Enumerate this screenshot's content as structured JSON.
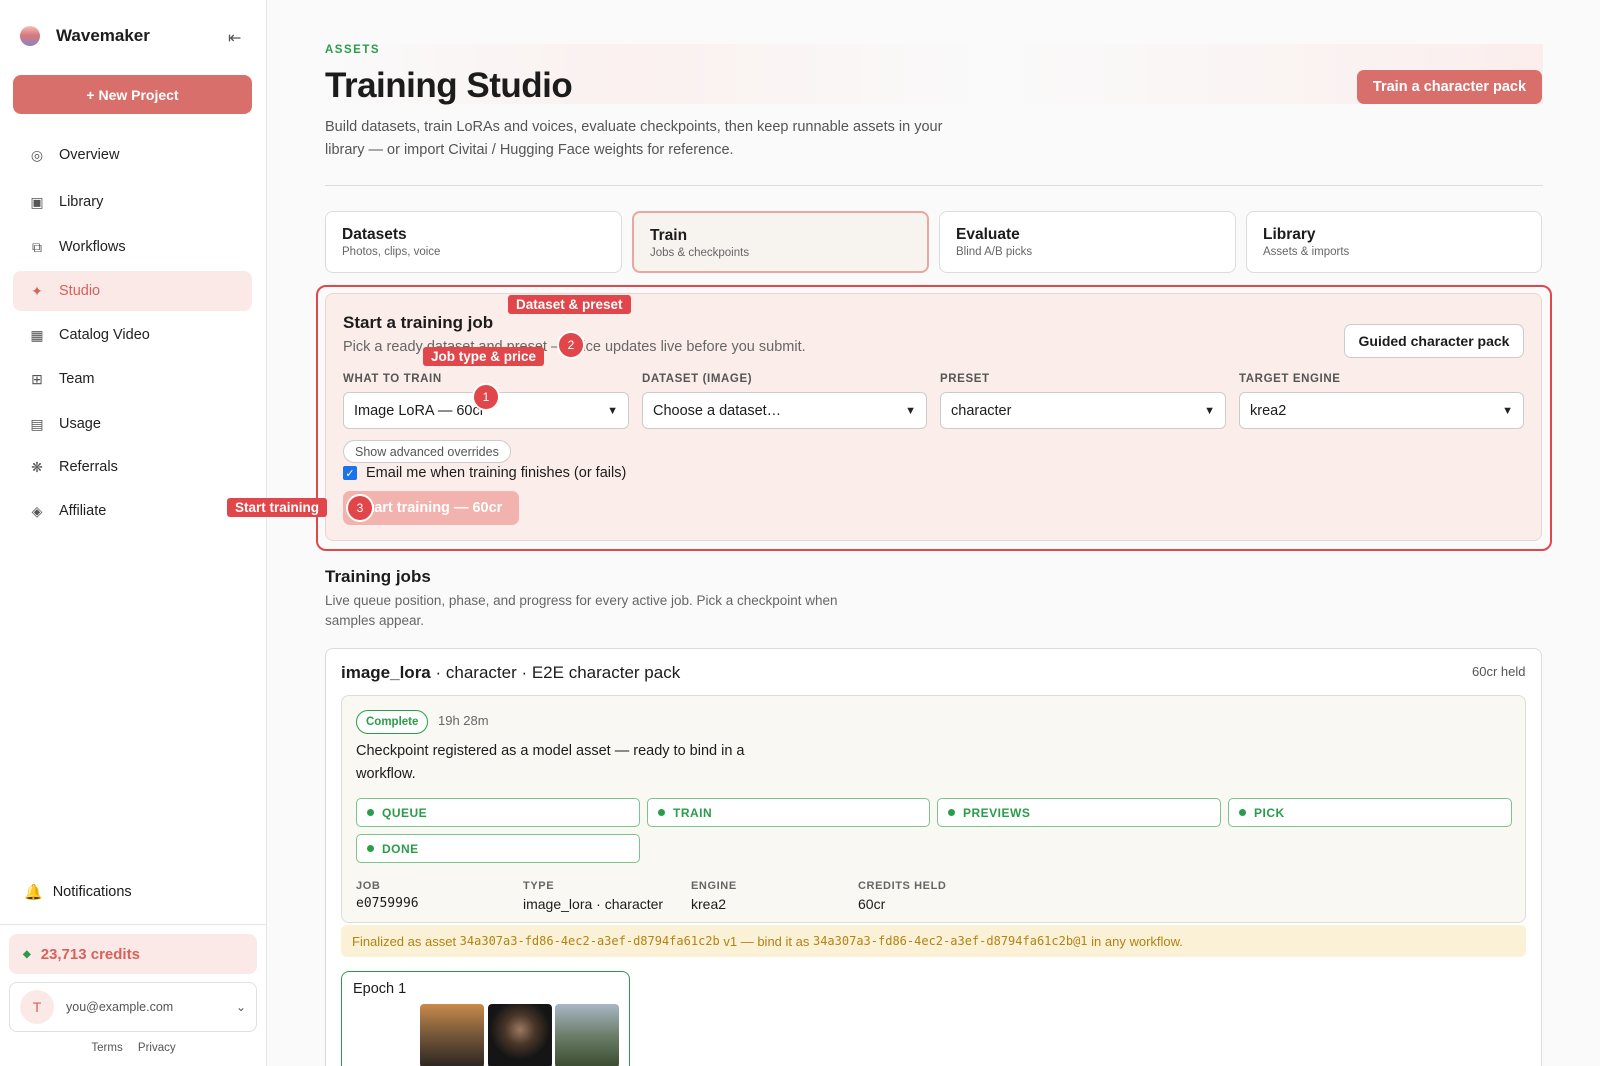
{
  "app": {
    "name": "Wavemaker",
    "new_project": "+ New Project"
  },
  "sidebar": {
    "items": [
      {
        "label": "Overview",
        "icon": "circle-icon"
      },
      {
        "label": "Library",
        "icon": "square-icon"
      },
      {
        "label": "Workflows",
        "icon": "copy-icon"
      },
      {
        "label": "Studio",
        "icon": "sparkle-icon"
      },
      {
        "label": "Catalog Video",
        "icon": "grid-icon"
      },
      {
        "label": "Team",
        "icon": "team-grid-icon"
      },
      {
        "label": "Usage",
        "icon": "list-icon"
      },
      {
        "label": "Referrals",
        "icon": "asterisk-icon"
      },
      {
        "label": "Affiliate",
        "icon": "diamond-icon"
      }
    ],
    "active": "Studio",
    "notifications": "Notifications",
    "credits": "23,713 credits",
    "user_initial": "T",
    "user_email": "you@example.com",
    "terms": "Terms",
    "privacy": "Privacy"
  },
  "header": {
    "eyebrow": "ASSETS",
    "title": "Training Studio",
    "description": "Build datasets, train LoRAs and voices, evaluate checkpoints, then keep runnable assets in your library — or import Civitai / Hugging Face weights for reference.",
    "cta": "Train a character pack"
  },
  "tabs": [
    {
      "title": "Datasets",
      "subtitle": "Photos, clips, voice"
    },
    {
      "title": "Train",
      "subtitle": "Jobs & checkpoints"
    },
    {
      "title": "Evaluate",
      "subtitle": "Blind A/B picks"
    },
    {
      "title": "Library",
      "subtitle": "Assets & imports"
    }
  ],
  "start_job": {
    "title": "Start a training job",
    "subtitle": "Pick a ready dataset and preset — price updates live before you submit.",
    "guided_button": "Guided character pack",
    "fields": [
      {
        "label": "WHAT TO TRAIN",
        "value": "Image LoRA — 60cr"
      },
      {
        "label": "DATASET (IMAGE)",
        "value": "Choose a dataset…"
      },
      {
        "label": "PRESET",
        "value": "character"
      },
      {
        "label": "TARGET ENGINE",
        "value": "krea2"
      }
    ],
    "advanced": "Show advanced overrides",
    "email_checkbox": "Email me when training finishes (or fails)",
    "email_checked": true,
    "start_button": "Start training — 60cr"
  },
  "annotations": {
    "tag_dataset": "Dataset & preset",
    "tag_job_type": "Job type & price",
    "tag_start": "Start training",
    "badge_1": "1",
    "badge_2": "2",
    "badge_3": "3"
  },
  "training_jobs": {
    "title": "Training jobs",
    "description": "Live queue position, phase, and progress for every active job. Pick a checkpoint when samples appear.",
    "job": {
      "kind": "image_lora",
      "rest": " · character · E2E character pack",
      "held": "60cr held",
      "status": "Complete",
      "elapsed": "19h 28m",
      "message": "Checkpoint registered as a model asset — ready to bind in a workflow.",
      "phases": [
        "QUEUE",
        "TRAIN",
        "PREVIEWS",
        "PICK",
        "DONE"
      ],
      "meta": [
        {
          "label": "JOB",
          "value": "e0759996"
        },
        {
          "label": "TYPE",
          "value": "image_lora · character"
        },
        {
          "label": "ENGINE",
          "value": "krea2"
        },
        {
          "label": "CREDITS HELD",
          "value": "60cr"
        }
      ],
      "finalized_prefix": "Finalized as asset ",
      "asset_id": "34a307a3-fd86-4ec2-a3ef-d8794fa61c2b",
      "finalized_mid": " v1 — bind it as ",
      "asset_ref": "34a307a3-fd86-4ec2-a3ef-d8794fa61c2b@1",
      "finalized_suffix": " in any workflow.",
      "epoch_label": "Epoch 1"
    }
  }
}
